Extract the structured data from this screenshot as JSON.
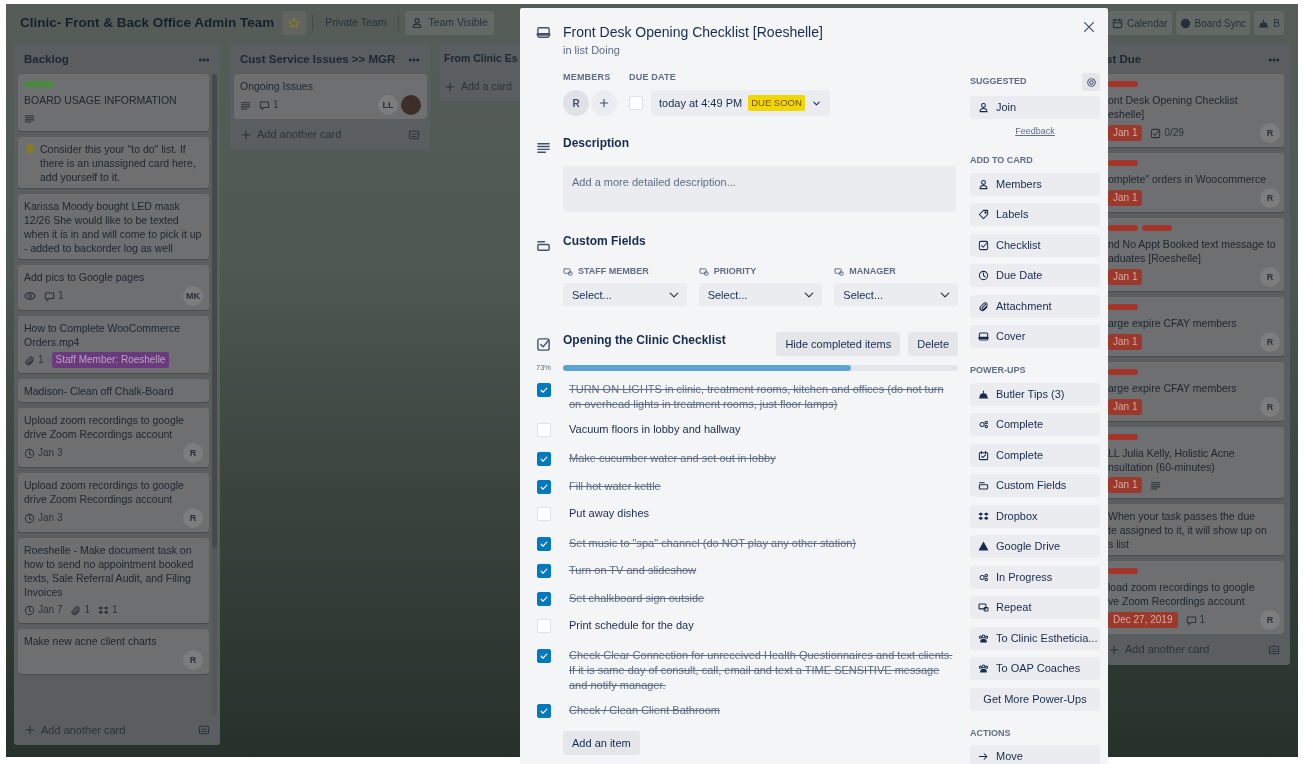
{
  "header": {
    "title": "Clinic- Front & Back Office Admin Team",
    "starred": true,
    "left_buttons": [
      {
        "label": "Private Team"
      },
      {
        "label": "Team Visible"
      }
    ],
    "right_buttons": [
      {
        "label": "Calendar"
      },
      {
        "label": "Board Sync"
      },
      {
        "label": "B"
      }
    ]
  },
  "lists": [
    {
      "title": "Backlog",
      "menu": true,
      "scrollable": true,
      "add_label": "Add another card",
      "cards": [
        {
          "labels": [
            {
              "color": "#4a8a3f"
            }
          ],
          "title": "BOARD USAGE INFORMATION",
          "badges": [
            {
              "kind": "description"
            }
          ]
        },
        {
          "has_icon": true,
          "title": "Consider this your \"to do\" list. If there is an unassigned card here, add yourself to it."
        },
        {
          "title": "Karissa Moody bought LED mask 12/26 She would like to be texted when it is in and will come to pick it up - added to backorder log as well"
        },
        {
          "title": "Add pics to Google pages",
          "badges": [
            {
              "kind": "watch"
            },
            {
              "kind": "comments",
              "text": "1"
            }
          ],
          "members": [
            {
              "kind": "initials",
              "text": "MK"
            }
          ]
        },
        {
          "title": "How to Complete WooCommerce Orders.mp4",
          "badges": [
            {
              "kind": "attachments",
              "text": "1"
            },
            {
              "kind": "tag",
              "text": "Staff Member: Roeshelle",
              "color": "#6a3a7c"
            }
          ]
        },
        {
          "title": "Madison- Clean off Chalk-Board"
        },
        {
          "title": "Upload zoom recordings to google drive Zoom Recordings account",
          "badges": [
            {
              "kind": "due",
              "text": "Jan 3",
              "overdue": false
            }
          ],
          "members": [
            {
              "kind": "initials",
              "text": "R"
            }
          ]
        },
        {
          "title": "Upload zoom recordings to google drive Zoom Recordings account",
          "badges": [
            {
              "kind": "due",
              "text": "Jan 3",
              "overdue": false
            }
          ],
          "members": [
            {
              "kind": "initials",
              "text": "R"
            }
          ]
        },
        {
          "title": "Roeshelle - Make document task on how to send no appointment booked texts, Sale Referral Audit, and Filing Invoices",
          "badges": [
            {
              "kind": "due",
              "text": "Jan 7",
              "overdue": false
            },
            {
              "kind": "attachments",
              "text": "1"
            },
            {
              "kind": "dropbox",
              "text": "1"
            }
          ]
        },
        {
          "title": "Make new acne client charts",
          "members": [
            {
              "kind": "initials",
              "text": "R"
            }
          ]
        }
      ]
    },
    {
      "title": "Cust Service Issues >> MGR",
      "menu": true,
      "scrollable": false,
      "add_label": "Add another card",
      "cards": [
        {
          "title": "Ongoing Issues",
          "badges": [
            {
              "kind": "description"
            },
            {
              "kind": "comments",
              "text": "1"
            }
          ],
          "members": [
            {
              "kind": "initials",
              "text": "LL"
            },
            {
              "kind": "photo"
            }
          ]
        }
      ]
    },
    {
      "title": "From Clinic Es",
      "menu": false,
      "scrollable": false,
      "add_label": "Add a card"
    }
  ],
  "right_list": {
    "title": "st Due",
    "menu": true,
    "add_label": "Add another card",
    "cards": [
      {
        "labels": [
          {
            "color": "#a3352a"
          }
        ],
        "lines": [
          "ont Desk Opening Checklist",
          "eshelle]"
        ],
        "badges": [
          {
            "kind": "due",
            "text": "Jan 1",
            "overdue": true
          },
          {
            "kind": "checklist",
            "text": "0/29"
          }
        ],
        "members": [
          {
            "kind": "initials",
            "text": "R"
          }
        ]
      },
      {
        "labels": [
          {
            "color": "#a3352a"
          }
        ],
        "lines": [
          "omplete\" orders in Woocommerce"
        ],
        "badges": [
          {
            "kind": "due",
            "text": "Jan 1",
            "overdue": true
          }
        ],
        "members": [
          {
            "kind": "initials",
            "text": "R"
          }
        ]
      },
      {
        "labels": [
          {
            "color": "#a3352a"
          },
          {
            "color": "#a3352a"
          }
        ],
        "lines": [
          "nd No Appt Booked text message to",
          "aduates [Roeshelle]"
        ],
        "badges": [
          {
            "kind": "due",
            "text": "Jan 1",
            "overdue": true
          }
        ],
        "members": [
          {
            "kind": "initials",
            "text": "R"
          }
        ]
      },
      {
        "labels": [
          {
            "color": "#a3352a"
          }
        ],
        "lines": [
          "arge expire CFAY members"
        ],
        "badges": [
          {
            "kind": "due",
            "text": "Jan 1",
            "overdue": true
          }
        ],
        "members": [
          {
            "kind": "initials",
            "text": "R"
          }
        ]
      },
      {
        "labels": [
          {
            "color": "#a3352a"
          }
        ],
        "lines": [
          "arge expire CFAY members"
        ],
        "badges": [
          {
            "kind": "due",
            "text": "Jan 1",
            "overdue": true
          }
        ],
        "members": [
          {
            "kind": "initials",
            "text": "R"
          }
        ]
      },
      {
        "labels": [
          {
            "color": "#a3352a"
          }
        ],
        "lines": [
          "LL Julia Kelly, Holistic Acne",
          "nsultation (60-minutes)"
        ],
        "badges": [
          {
            "kind": "due",
            "text": "Jan 1",
            "overdue": true
          },
          {
            "kind": "description"
          }
        ]
      },
      {
        "lines": [
          "When your task passes the due",
          "te assigned to it, it will show up on",
          "s list"
        ]
      },
      {
        "labels": [
          {
            "color": "#a3352a"
          }
        ],
        "lines": [
          "load zoom recordings to google",
          "ve Zoom Recordings account"
        ],
        "badges": [
          {
            "kind": "due",
            "text": "Dec 27, 2019",
            "overdue": true
          },
          {
            "kind": "comments",
            "text": "1"
          }
        ],
        "members": [
          {
            "kind": "initials",
            "text": "R"
          }
        ]
      }
    ]
  },
  "card_modal": {
    "title": "Front Desk Opening Checklist [Roeshelle]",
    "list_prefix": "in list",
    "list_name": "Doing",
    "members_label": "MEMBERS",
    "members": [
      {
        "text": "R"
      }
    ],
    "due_label": "DUE DATE",
    "due": {
      "checked": false,
      "text": "today at 4:49 PM",
      "status": "DUE SOON"
    },
    "description": {
      "heading": "Description",
      "placeholder": "Add a more detailed description..."
    },
    "custom_fields": {
      "heading": "Custom Fields",
      "fields": [
        {
          "name": "STAFF MEMBER",
          "placeholder": "Select..."
        },
        {
          "name": "PRIORITY",
          "placeholder": "Select..."
        },
        {
          "name": "MANAGER",
          "placeholder": "Select..."
        }
      ]
    },
    "checklist": {
      "title": "Opening the Clinic Checklist",
      "hide_button": "Hide completed items",
      "delete_button": "Delete",
      "percent": "73%",
      "level": 0.73,
      "add_button": "Add an item",
      "items": [
        {
          "text": "TURN ON LIGHTS in clinic, treatment rooms, kitchen and offices (do not turn on overhead lights in treatment rooms, just floor lamps)",
          "checked": true
        },
        {
          "text": "Vacuum floors in lobby and hallway",
          "checked": false
        },
        {
          "text": "Make cucumber water and set out in lobby",
          "checked": true
        },
        {
          "text": "Fill hot water kettle",
          "checked": true
        },
        {
          "text": "Put away dishes",
          "checked": false
        },
        {
          "text": "Set music to \"spa\" channel (do NOT play any other station)",
          "checked": true
        },
        {
          "text": "Turn on TV and slideshow",
          "checked": true
        },
        {
          "text": "Set chalkboard sign outside",
          "checked": true
        },
        {
          "text": "Print schedule for the day",
          "checked": false
        },
        {
          "text": "Check Clear Connection for unreceived Health Questionnaires and text clients. If it is same day of consult, call, email and text a TIME SENSITIVE message and notify manager.",
          "checked": true
        },
        {
          "text": "Check / Clean Client Bathroom",
          "checked": true
        }
      ]
    }
  },
  "sidebar": {
    "sections": [
      {
        "heading": "SUGGESTED",
        "settings": true,
        "buttons": [
          {
            "label": "Join"
          }
        ],
        "link": "Feedback"
      },
      {
        "heading": "ADD TO CARD",
        "buttons": [
          {
            "label": "Members"
          },
          {
            "label": "Labels"
          },
          {
            "label": "Checklist"
          },
          {
            "label": "Due Date"
          },
          {
            "label": "Attachment"
          },
          {
            "label": "Cover"
          }
        ]
      },
      {
        "heading": "POWER-UPS",
        "buttons": [
          {
            "label": "Butler Tips (3)"
          },
          {
            "label": "Complete"
          },
          {
            "label": "Complete"
          },
          {
            "label": "Custom Fields"
          },
          {
            "label": "Dropbox"
          },
          {
            "label": "Google Drive"
          },
          {
            "label": "In Progress"
          },
          {
            "label": "Repeat"
          },
          {
            "label": "To Clinic Estheticia..."
          },
          {
            "label": "To OAP Coaches"
          }
        ],
        "get_more": "Get More Power-Ups"
      },
      {
        "heading": "ACTIONS",
        "buttons": [
          {
            "label": "Move"
          }
        ]
      }
    ]
  }
}
